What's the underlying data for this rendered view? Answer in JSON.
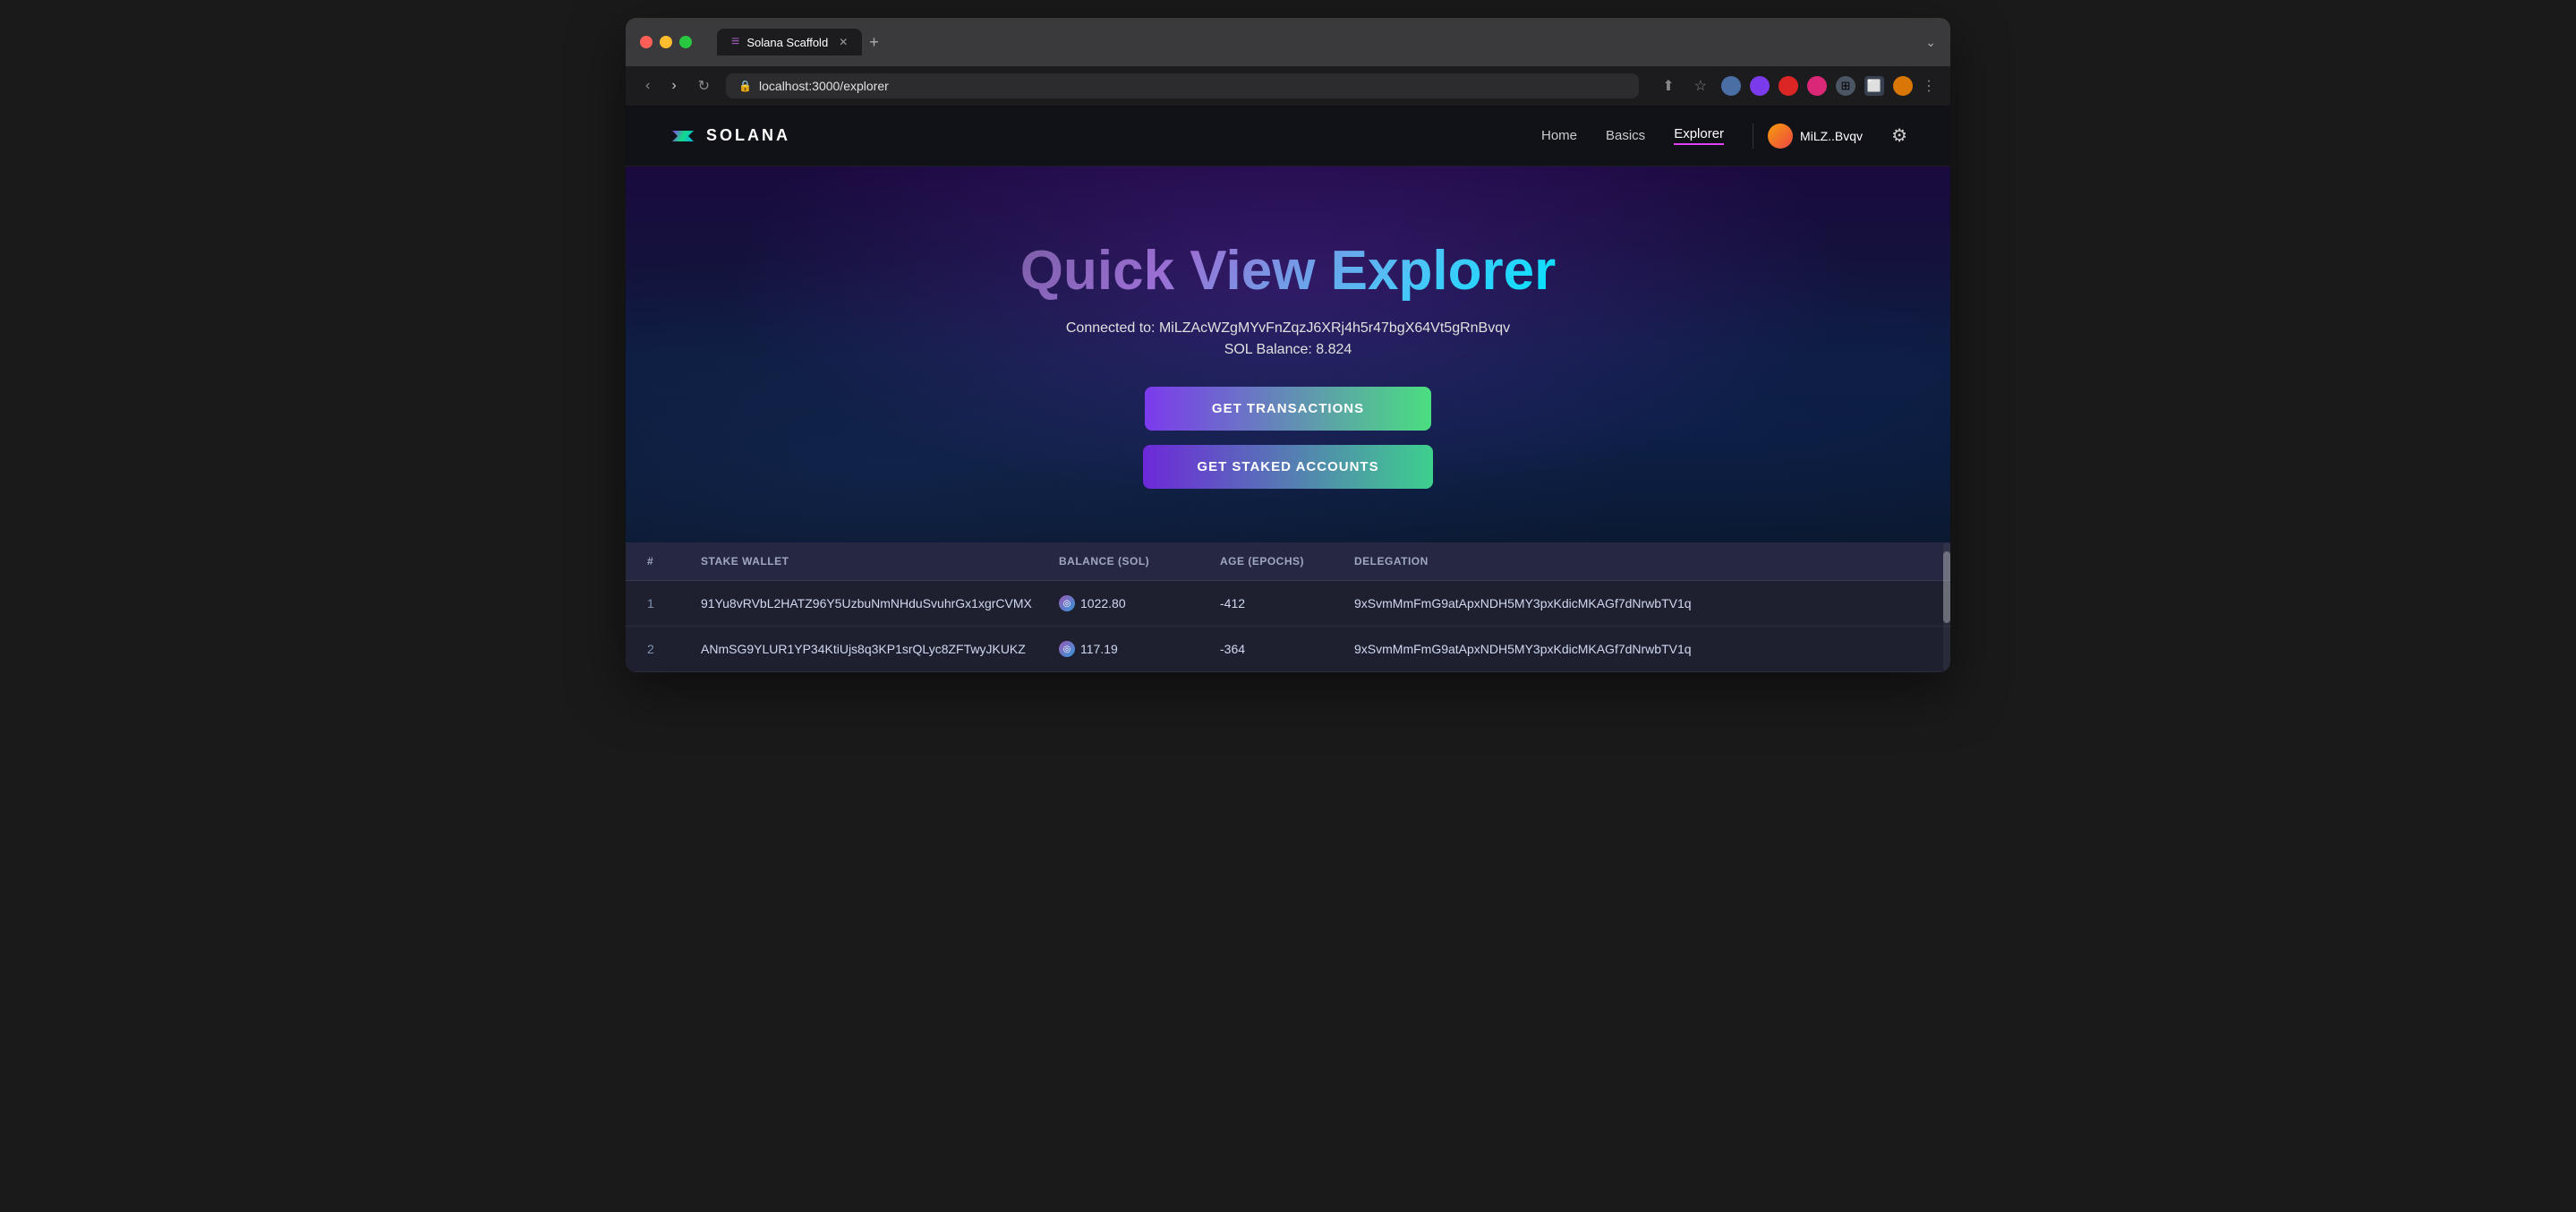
{
  "browser": {
    "tab_title": "Solana Scaffold",
    "url": "localhost:3000/explorer",
    "tab_icon": "≡",
    "expand_icon": "⌄"
  },
  "nav": {
    "logo_text": "SOLANA",
    "home_label": "Home",
    "basics_label": "Basics",
    "explorer_label": "Explorer",
    "wallet_address": "MiLZ..Bvqv",
    "settings_icon": "⚙"
  },
  "hero": {
    "title": "Quick View Explorer",
    "connected_label": "Connected to: MiLZAcWZgMYvFnZqzJ6XRj4h5r47bgX64Vt5gRnBvqv",
    "balance_label": "SOL Balance: 8.824",
    "get_transactions_label": "GET TRANSACTIONS",
    "get_staked_label": "GET STAKED ACCOUNTS"
  },
  "table": {
    "headers": [
      "#",
      "STAKE WALLET",
      "BALANCE (SOL)",
      "AGE (EPOCHS)",
      "DELEGATION"
    ],
    "rows": [
      {
        "num": "1",
        "wallet": "91Yu8vRVbL2HATZ96Y5UzbuNmNHduSvuhrGx1xgrCVMX",
        "balance": "1022.80",
        "age": "-412",
        "delegation": "9xSvmMmFmG9atApxNDH5MY3pxKdicMKAGf7dNrwbTV1q"
      },
      {
        "num": "2",
        "wallet": "ANmSG9YLUR1YP34KtiUjs8q3KP1srQLyc8ZFTwyJKUKZ",
        "balance": "117.19",
        "age": "-364",
        "delegation": "9xSvmMmFmG9atApxNDH5MY3pxKdicMKAGf7dNrwbTV1q"
      }
    ]
  }
}
